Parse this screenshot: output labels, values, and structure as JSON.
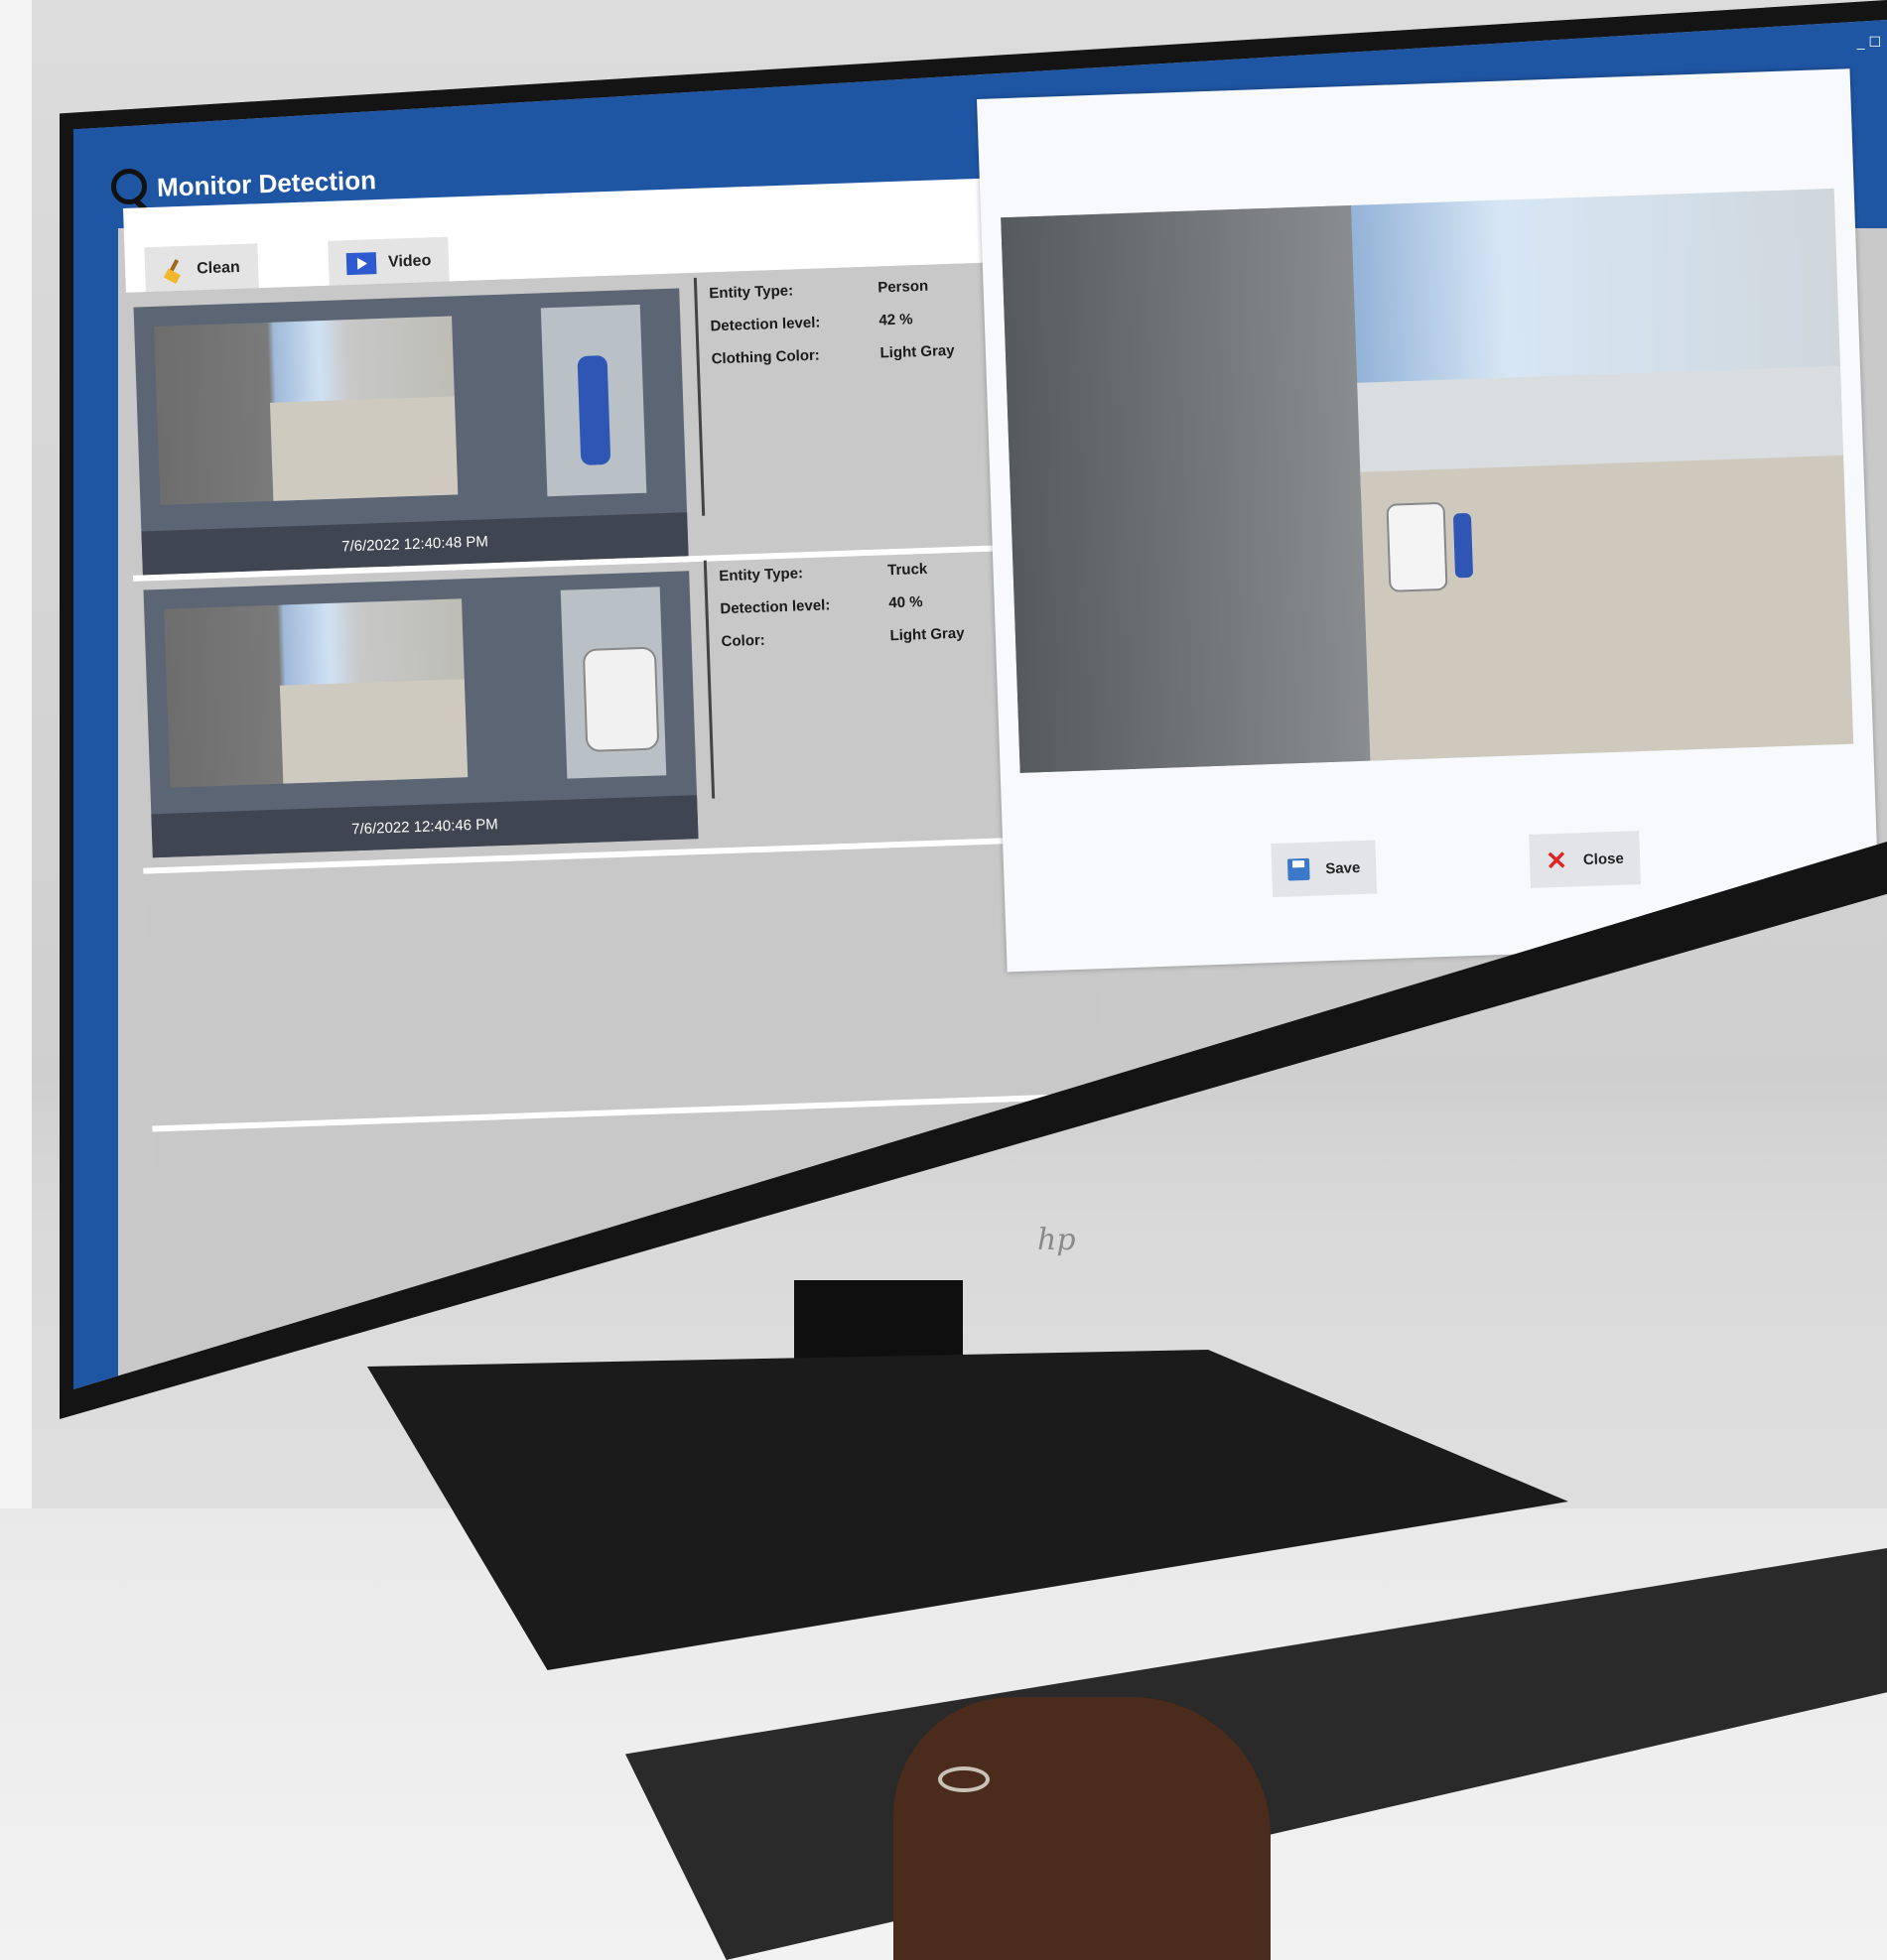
{
  "app": {
    "title": "Monitor Detection",
    "window_controls": "_ ☐"
  },
  "toolbar": {
    "clean_label": "Clean",
    "video_label": "Video"
  },
  "detections": [
    {
      "timestamp": "7/6/2022 12:40:48 PM",
      "fields": [
        {
          "label": "Entity Type:",
          "value": "Person"
        },
        {
          "label": "Detection level:",
          "value": "42 %"
        },
        {
          "label": "Clothing Color:",
          "value": "Light Gray"
        }
      ]
    },
    {
      "timestamp": "7/6/2022 12:40:46 PM",
      "fields": [
        {
          "label": "Entity Type:",
          "value": "Truck"
        },
        {
          "label": "Detection level:",
          "value": "40 %"
        },
        {
          "label": "Color:",
          "value": "Light Gray"
        }
      ]
    }
  ],
  "dialog": {
    "save_label": "Save",
    "close_label": "Close"
  },
  "monitor": {
    "brand": "hp"
  },
  "colors": {
    "titlebar": "#1f56a4",
    "list_bg": "#c8c8c8",
    "card_bg": "#5b6573",
    "close_x": "#e02424"
  }
}
